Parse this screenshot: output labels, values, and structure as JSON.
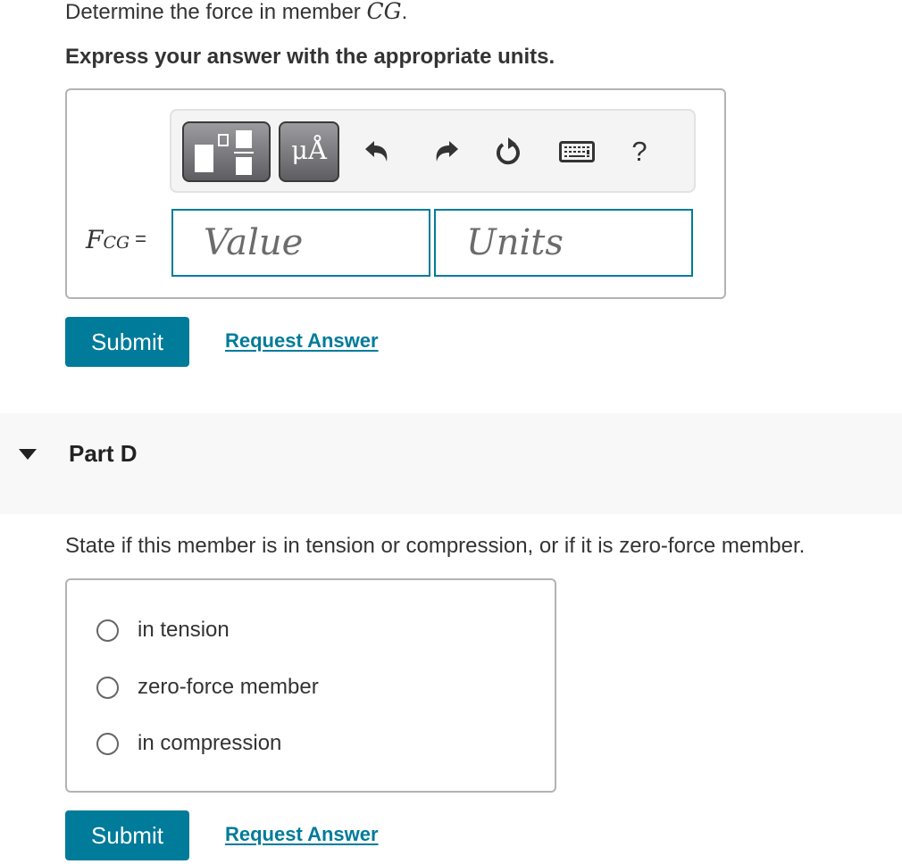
{
  "question": {
    "prefix": "Determine the force in member ",
    "member": "CG",
    "suffix": ".",
    "instruction": "Express your answer with the appropriate units."
  },
  "toolbar": {
    "templates_button": "templates",
    "units_button_glyph": "μÅ",
    "undo": "undo",
    "redo": "redo",
    "reset": "reset",
    "keyboard": "keyboard",
    "help_label": "?"
  },
  "answer": {
    "variable": "F",
    "subscript": "CG",
    "equals": "=",
    "value_placeholder": "Value",
    "value": "",
    "units_placeholder": "Units",
    "units": ""
  },
  "part_c_actions": {
    "submit_label": "Submit",
    "request_label": "Request Answer"
  },
  "part_d": {
    "title": "Part D",
    "expanded": true,
    "prompt": "State if this member is in tension or compression, or if it is zero-force member.",
    "options": [
      {
        "label": "in tension",
        "selected": false
      },
      {
        "label": "zero-force member",
        "selected": false
      },
      {
        "label": "in compression",
        "selected": false
      }
    ],
    "submit_label": "Submit",
    "request_label": "Request Answer"
  },
  "colors": {
    "accent": "#007b9a",
    "text": "#333333",
    "section_bg": "#f8f8f8"
  }
}
